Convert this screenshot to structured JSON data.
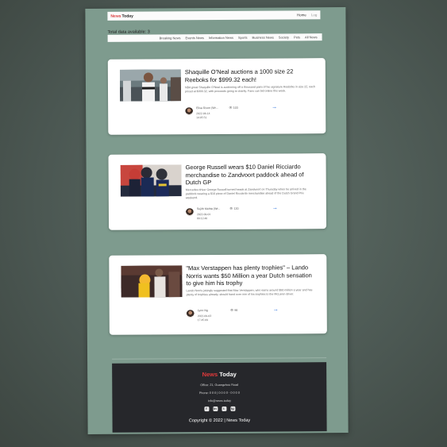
{
  "brand": {
    "part1": "News",
    "part2": "Today"
  },
  "topnav": {
    "links": [
      "Home",
      "Log"
    ]
  },
  "total_label": "Total data available: 3",
  "categories": [
    "Breaking News",
    "Events News",
    "Information News",
    "Sports",
    "Business News",
    "Society",
    "Pets",
    "All News"
  ],
  "cards": [
    {
      "title": "Shaquille O'Neal auctions a 1000 size 22 Reeboks for $999.32 each!",
      "description": "NBA great Shaquille O'Neal is auctioning off a thousand pairs of his signature Reeboks in size 22, each priced at $999.32, with proceeds going to charity. Fans can bid online this week.",
      "author": "Elisa Rixon (Wr...",
      "views": "103",
      "date": [
        "2022-06-14",
        "14:05:51"
      ],
      "arrow": "→"
    },
    {
      "title": "George Russell wears $10 Daniel Ricciardo merchandise to Zandvoort paddock ahead of Dutch GP",
      "description": "Mercedes driver George Russell turned heads at Zandvoort on Thursday when he arrived in the paddock wearing a $10 piece of Daniel Ricciardo merchandise ahead of the Dutch Grand Prix weekend.",
      "author": "Sujith Mehta (Wr...",
      "views": "120",
      "date": [
        "2022-09-01",
        "09:12:40"
      ],
      "arrow": "→"
    },
    {
      "title": "\"Max Verstappen has plenty trophies\" – Lando Norris wants $50 Million a year Dutch sensation to give him his trophy",
      "description": "Lando Norris jokingly suggested that Max Verstappen, who earns around $50 million a year and has plenty of trophies already, should hand over one of his trophies to the McLaren driver.",
      "author": "Lynn Ng",
      "views": "98",
      "date": [
        "2022-09-03",
        "17:45:09"
      ],
      "arrow": "→"
    }
  ],
  "footer": {
    "brand1": "News",
    "brand2": "Today",
    "lines": [
      "Office: 21, Guangzhou Road",
      "Phone: 0 0 0 | 0 0 0 0 - 0 0 0 0",
      "info@news.today"
    ],
    "socials": [
      "f",
      "in",
      "t",
      "ig"
    ],
    "copyright": "Copyright © 2022 | News Today"
  }
}
